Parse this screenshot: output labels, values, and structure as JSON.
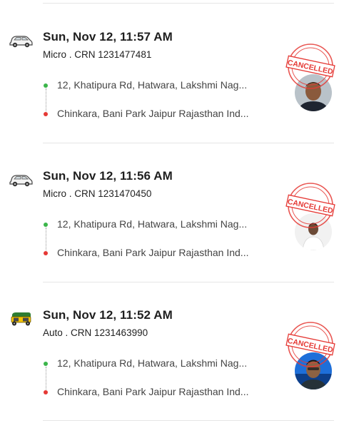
{
  "rides": [
    {
      "vehicle_icon": "car-icon",
      "datetime": "Sun, Nov 12, 11:57 AM",
      "crn_line": "Micro . CRN 1231477481",
      "pickup": "12, Khatipura Rd, Hatwara, Lakshmi Nag...",
      "drop": "Chinkara, Bani Park Jaipur Rajasthan Ind...",
      "status": "CANCELLED"
    },
    {
      "vehicle_icon": "car-icon",
      "datetime": "Sun, Nov 12, 11:56 AM",
      "crn_line": "Micro . CRN 1231470450",
      "pickup": "12, Khatipura Rd, Hatwara, Lakshmi Nag...",
      "drop": "Chinkara, Bani Park Jaipur Rajasthan Ind...",
      "status": "CANCELLED"
    },
    {
      "vehicle_icon": "auto-rickshaw-icon",
      "datetime": "Sun, Nov 12, 11:52 AM",
      "crn_line": "Auto . CRN 1231463990",
      "pickup": "12, Khatipura Rd, Hatwara, Lakshmi Nag...",
      "drop": "Chinkara, Bani Park Jaipur Rajasthan Ind...",
      "status": "CANCELLED"
    }
  ],
  "colors": {
    "stamp_red": "#e53935",
    "pickup_dot": "#3bb54a",
    "drop_dot": "#e53935",
    "auto_yellow": "#f5c400",
    "auto_green": "#2e7d32"
  }
}
